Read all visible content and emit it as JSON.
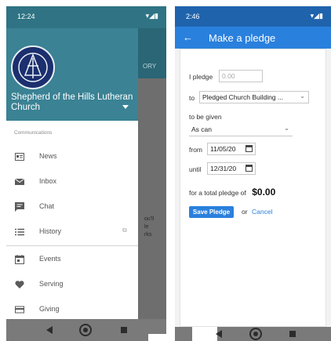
{
  "left": {
    "status": {
      "time": "12:24",
      "icons": "▾◢▮"
    },
    "drawer": {
      "church_name": "Shepherd of the Hills Lutheran Church",
      "section_label": "Communications",
      "items": [
        {
          "label": "News",
          "icon": "news-icon"
        },
        {
          "label": "Inbox",
          "icon": "mail-icon"
        },
        {
          "label": "Chat",
          "icon": "chat-icon"
        },
        {
          "label": "History",
          "icon": "list-icon",
          "external": true
        },
        {
          "label": "Events",
          "icon": "calendar-icon"
        },
        {
          "label": "Serving",
          "icon": "heart-icon"
        },
        {
          "label": "Giving",
          "icon": "card-icon"
        }
      ]
    },
    "behind": {
      "tab_text": "ORY",
      "snippet_lines": [
        "ou'll",
        "le",
        "rks"
      ]
    }
  },
  "right": {
    "status": {
      "time": "2:46",
      "icons": "▾◢▮"
    },
    "appbar": {
      "title": "Make a pledge"
    },
    "form": {
      "pledge_label": "I pledge",
      "amount_placeholder": "0.00",
      "to_label": "to",
      "fund_value": "Pledged Church Building ...",
      "given_label": "to be given",
      "frequency_value": "As can",
      "from_label": "from",
      "from_date": "11/05/20",
      "until_label": "until",
      "until_date": "12/31/20",
      "total_label": "for a total pledge of",
      "total_value": "$0.00",
      "save_label": "Save Pledge",
      "or_text": "or",
      "cancel_label": "Cancel"
    }
  },
  "colors": {
    "teal_status": "#2f7384",
    "teal_header": "#3a8294",
    "blue_status": "#1f63ad",
    "blue_appbar": "#2a80dd"
  }
}
